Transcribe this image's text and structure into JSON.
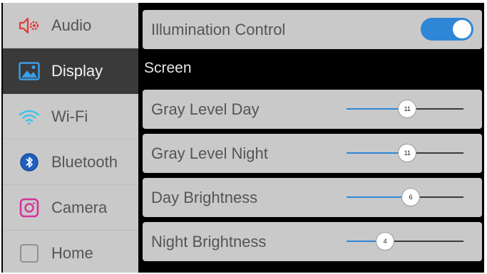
{
  "sidebar": {
    "items": [
      {
        "label": "Audio",
        "icon": "speaker-gear-icon",
        "active": false
      },
      {
        "label": "Display",
        "icon": "image-icon",
        "active": true
      },
      {
        "label": "Wi-Fi",
        "icon": "wifi-icon",
        "active": false
      },
      {
        "label": "Bluetooth",
        "icon": "bluetooth-icon",
        "active": false
      },
      {
        "label": "Camera",
        "icon": "camera-icon",
        "active": false
      },
      {
        "label": "Home",
        "icon": "home-square-icon",
        "active": false
      }
    ]
  },
  "main": {
    "illumination": {
      "label": "Illumination Control",
      "enabled": true
    },
    "section_title": "Screen",
    "sliders": [
      {
        "label": "Gray Level Day",
        "value": "11",
        "fill_percent": 52
      },
      {
        "label": "Gray Level Night",
        "value": "11",
        "fill_percent": 52
      },
      {
        "label": "Day Brightness",
        "value": "6",
        "fill_percent": 55
      },
      {
        "label": "Night Brightness",
        "value": "4",
        "fill_percent": 33
      }
    ]
  },
  "colors": {
    "accent": "#2f86d6",
    "panel": "#c9c9c9",
    "active_item": "#3a3a3a",
    "background": "#000000",
    "audio_icon": "#e53935",
    "camera_icon": "#d6339b"
  }
}
